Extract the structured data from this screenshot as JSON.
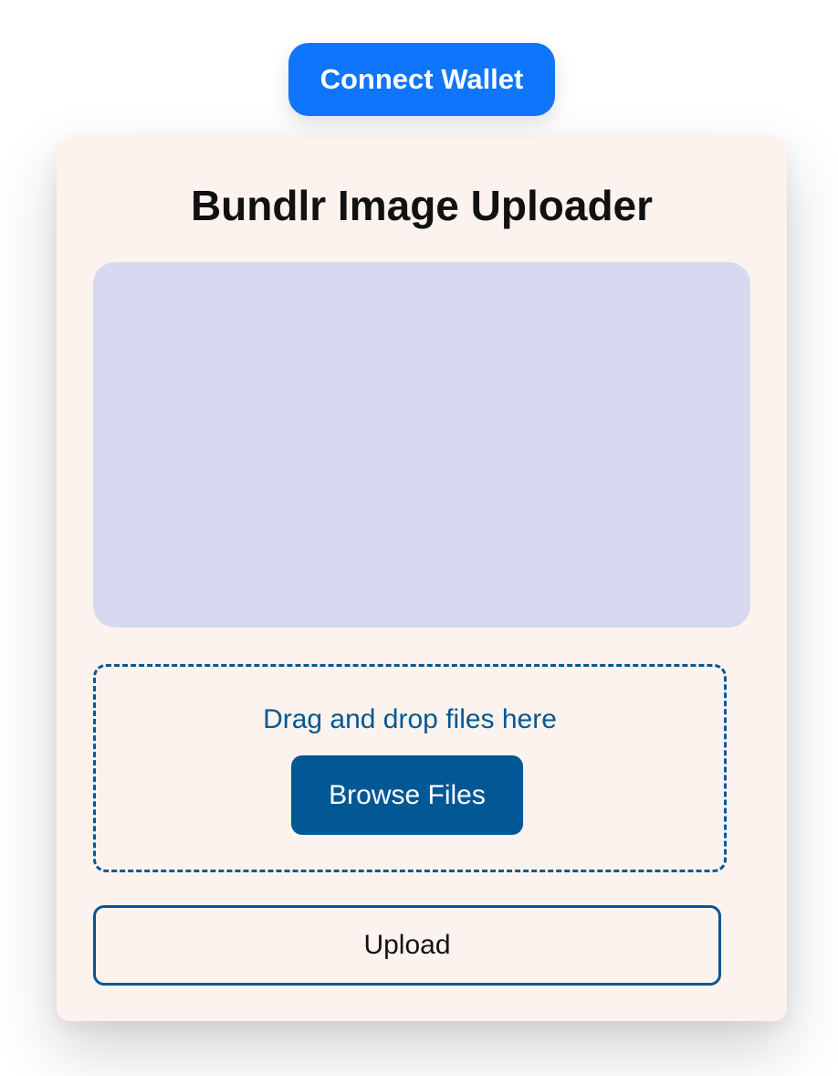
{
  "header": {
    "connect_wallet_label": "Connect Wallet"
  },
  "uploader": {
    "title": "Bundlr Image Uploader",
    "dropzone_text": "Drag and drop files here",
    "browse_label": "Browse Files",
    "upload_label": "Upload"
  },
  "colors": {
    "connect_button": "#0f75fb",
    "card_background": "#fcf3ee",
    "preview_background": "#d6d9ef",
    "accent": "#015894"
  }
}
